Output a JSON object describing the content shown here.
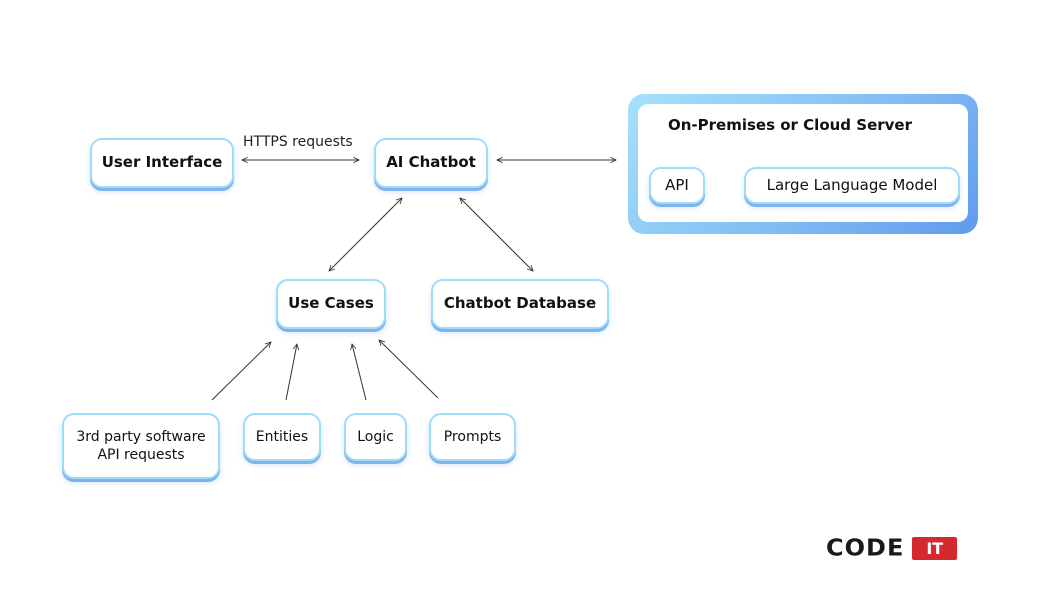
{
  "diagram": {
    "nodes": {
      "user_interface": "User Interface",
      "ai_chatbot": "AI Chatbot",
      "use_cases": "Use Cases",
      "chatbot_database": "Chatbot Database",
      "third_party": "3rd party software API requests",
      "entities": "Entities",
      "logic": "Logic",
      "prompts": "Prompts"
    },
    "server": {
      "title": "On-Premises or Cloud Server",
      "api": "API",
      "llm": "Large Language Model"
    },
    "edge_labels": {
      "ui_to_chatbot": "HTTPS requests"
    },
    "edges": [
      {
        "from": "user_interface",
        "to": "ai_chatbot",
        "type": "bidirectional",
        "label": "HTTPS requests"
      },
      {
        "from": "ai_chatbot",
        "to": "server",
        "type": "bidirectional"
      },
      {
        "from": "api",
        "to": "llm",
        "type": "bidirectional"
      },
      {
        "from": "ai_chatbot",
        "to": "use_cases",
        "type": "bidirectional"
      },
      {
        "from": "ai_chatbot",
        "to": "chatbot_database",
        "type": "bidirectional"
      },
      {
        "from": "third_party",
        "to": "use_cases",
        "type": "directed"
      },
      {
        "from": "entities",
        "to": "use_cases",
        "type": "directed"
      },
      {
        "from": "logic",
        "to": "use_cases",
        "type": "directed"
      },
      {
        "from": "prompts",
        "to": "use_cases",
        "type": "directed"
      }
    ]
  },
  "logo": {
    "code": "CODE",
    "it": "IT",
    "accent_color": "#d42a2f"
  }
}
